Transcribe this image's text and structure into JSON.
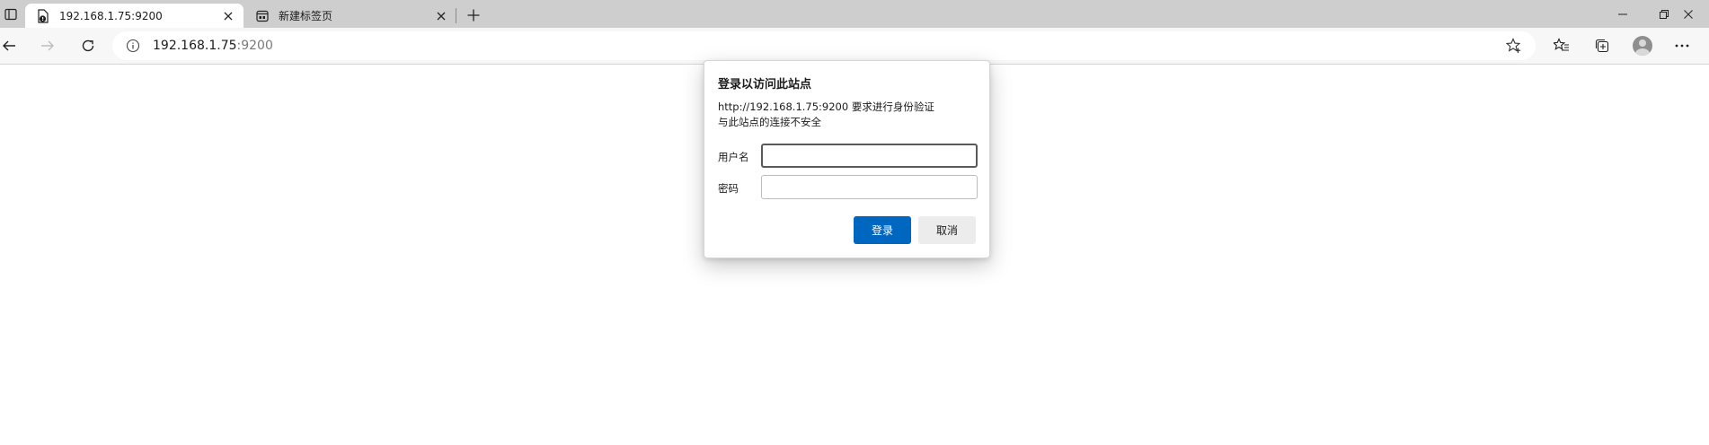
{
  "tabs": [
    {
      "title": "192.168.1.75:9200",
      "active": true,
      "favicon": "page-warning-icon"
    },
    {
      "title": "新建标签页",
      "active": false,
      "favicon": "new-tab-page-icon"
    }
  ],
  "toolbar": {
    "address": {
      "host": "192.168.1.75",
      "port": ":9200"
    }
  },
  "dialog": {
    "title": "登录以访问此站点",
    "message_line1": "http://192.168.1.75:9200 要求进行身份验证",
    "message_line2": "与此站点的连接不安全",
    "username_label": "用户名",
    "password_label": "密码",
    "username_value": "",
    "password_value": "",
    "login_label": "登录",
    "cancel_label": "取消",
    "primary_color": "#0067c0"
  }
}
